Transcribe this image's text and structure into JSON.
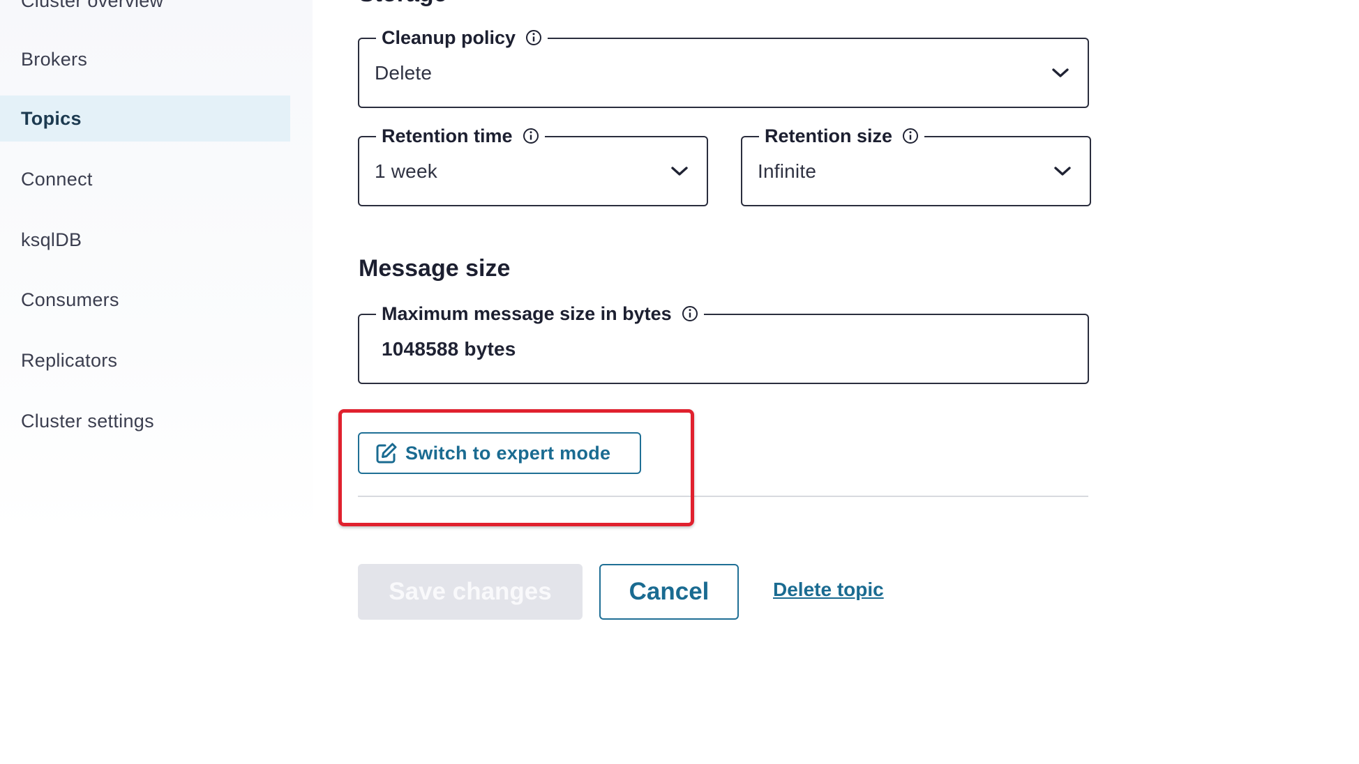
{
  "sidebar": {
    "items": [
      {
        "label": "Cluster overview",
        "active": false
      },
      {
        "label": "Brokers",
        "active": false
      },
      {
        "label": "Topics",
        "active": true
      },
      {
        "label": "Connect",
        "active": false
      },
      {
        "label": "ksqlDB",
        "active": false
      },
      {
        "label": "Consumers",
        "active": false
      },
      {
        "label": "Replicators",
        "active": false
      },
      {
        "label": "Cluster settings",
        "active": false
      }
    ]
  },
  "storage": {
    "title": "Storage",
    "cleanup_policy": {
      "label": "Cleanup policy",
      "value": "Delete"
    },
    "retention_time": {
      "label": "Retention time",
      "value": "1 week"
    },
    "retention_size": {
      "label": "Retention size",
      "value": "Infinite"
    }
  },
  "message_size": {
    "title": "Message size",
    "max_bytes": {
      "label": "Maximum message size in bytes",
      "value": "1048588 bytes"
    }
  },
  "actions": {
    "expert_mode": "Switch to expert mode",
    "save": "Save changes",
    "cancel": "Cancel",
    "delete": "Delete topic"
  },
  "colors": {
    "accent": "#1a6b91",
    "highlight": "#e0212e",
    "active_nav_bg": "#e4f1f8",
    "disabled_bg": "#e3e4ea"
  },
  "icons": {
    "info": "info-circle-icon",
    "chevron": "chevron-down-icon",
    "edit": "edit-icon"
  }
}
